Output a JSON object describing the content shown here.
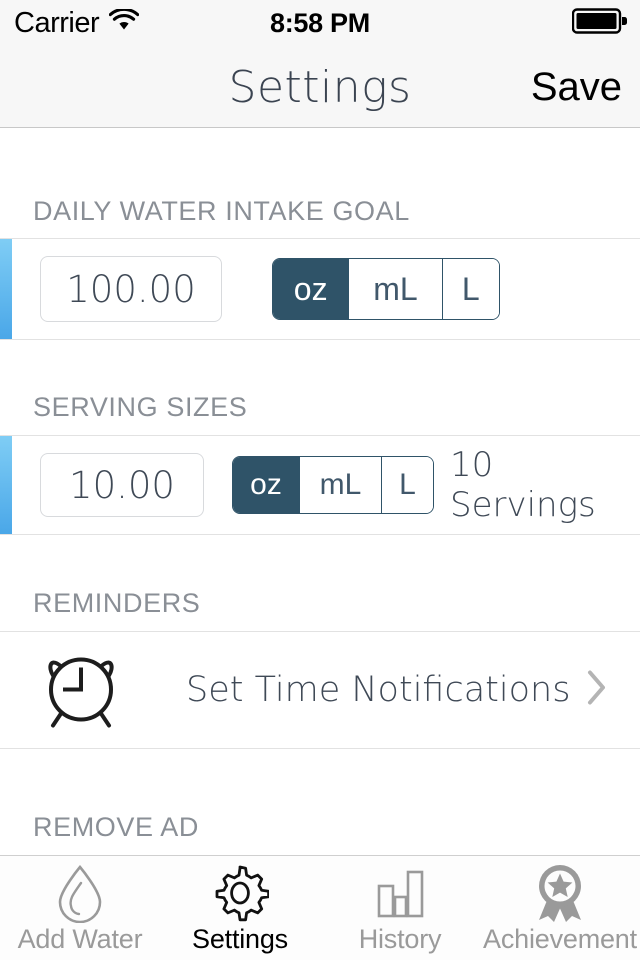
{
  "status_bar": {
    "carrier": "Carrier",
    "wifi_icon": "wifi-icon",
    "time": "8:58 PM",
    "battery_icon": "battery-full-icon"
  },
  "nav_bar": {
    "title": "Settings",
    "save_label": "Save"
  },
  "sections": {
    "goal": {
      "header": "DAILY WATER INTAKE GOAL",
      "value": "100.00",
      "units": [
        "oz",
        "mL",
        "L"
      ],
      "selected_unit": "oz"
    },
    "serving": {
      "header": "SERVING SIZES",
      "value": "10.00",
      "units": [
        "oz",
        "mL",
        "L"
      ],
      "selected_unit": "oz",
      "servings_label": "10 Servings"
    },
    "reminders": {
      "header": "REMINDERS",
      "item_label": "Set Time Notifications",
      "item_icon": "alarm-clock-icon",
      "chevron_icon": "chevron-right-icon"
    },
    "remove_ad": {
      "header": "REMOVE AD"
    }
  },
  "tab_bar": {
    "items": [
      {
        "label": "Add Water",
        "icon": "water-drop-icon",
        "active": false
      },
      {
        "label": "Settings",
        "icon": "gear-icon",
        "active": true
      },
      {
        "label": "History",
        "icon": "bar-chart-icon",
        "active": false
      },
      {
        "label": "Achievement",
        "icon": "medal-icon",
        "active": false
      }
    ]
  },
  "colors": {
    "accent_blue_light": "#7fcdf5",
    "accent_blue_dark": "#4aa7e8",
    "segment_selected": "#2f5368",
    "header_gray": "#8a8f96",
    "text_slate": "#3f4956",
    "tab_inactive": "#9a9a9a",
    "tab_active": "#000000"
  }
}
